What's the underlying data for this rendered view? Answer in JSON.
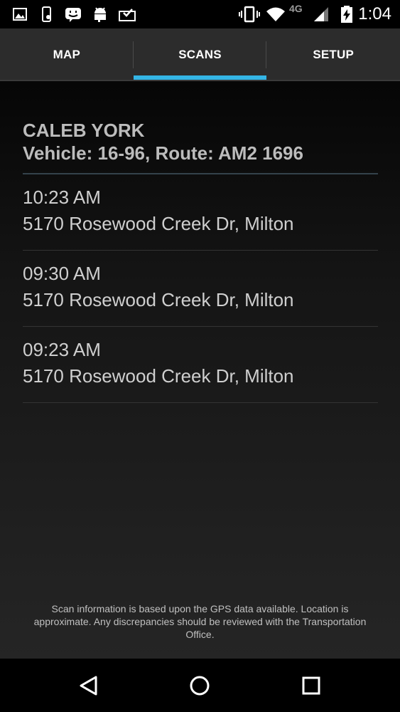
{
  "status_bar": {
    "time": "1:04",
    "network_label": "4G",
    "icons": [
      "image-icon",
      "phone-icon",
      "messenger-icon",
      "android-icon",
      "inbox-check-icon",
      "vibrate-icon",
      "wifi-icon",
      "signal-icon",
      "battery-charging-icon"
    ]
  },
  "tabs": [
    {
      "label": "MAP",
      "active": false
    },
    {
      "label": "SCANS",
      "active": true
    },
    {
      "label": "SETUP",
      "active": false
    }
  ],
  "accent_color": "#34b5e5",
  "header": {
    "driver_name": "CALEB YORK",
    "vehicle_line": "Vehicle: 16-96, Route: AM2 1696"
  },
  "scans": [
    {
      "time": "10:23 AM",
      "address": "5170 Rosewood Creek Dr, Milton"
    },
    {
      "time": "09:30 AM",
      "address": "5170 Rosewood Creek Dr, Milton"
    },
    {
      "time": "09:23 AM",
      "address": "5170 Rosewood Creek Dr, Milton"
    }
  ],
  "disclaimer": "Scan information is based upon the GPS data available. Location is approximate. Any discrepancies should be reviewed with the Transportation Office.",
  "nav": {
    "buttons": [
      "back-icon",
      "home-icon",
      "recents-icon"
    ]
  }
}
